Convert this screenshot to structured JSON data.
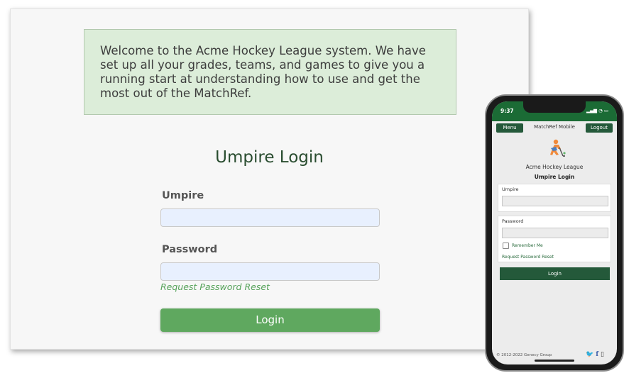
{
  "desktop": {
    "welcome_text": "Welcome to the Acme Hockey League system. We have set up all your grades, teams, and games to give you a running start at understanding how to use and get the most out of the MatchRef.",
    "title": "Umpire Login",
    "umpire_label": "Umpire",
    "password_label": "Password",
    "reset_link": "Request Password Reset",
    "login_button": "Login"
  },
  "mobile": {
    "time": "9:37",
    "menu_button": "Menu",
    "nav_title": "MatchRef Mobile",
    "logout_button": "Logout",
    "league_name": "Acme Hockey League",
    "title": "Umpire Login",
    "umpire_label": "Umpire",
    "password_label": "Password",
    "remember_me": "Remember Me",
    "reset_link": "Request Password Reset",
    "login_button": "Login",
    "footer": "© 2012-2022 Genecy Group",
    "icons": [
      "twitter-icon",
      "facebook-icon",
      "phone-icon"
    ]
  },
  "colors": {
    "accent_green": "#5fa85f",
    "dark_green": "#24593a",
    "welcome_bg": "#dcedd9",
    "input_bg": "#e8f0fe"
  }
}
